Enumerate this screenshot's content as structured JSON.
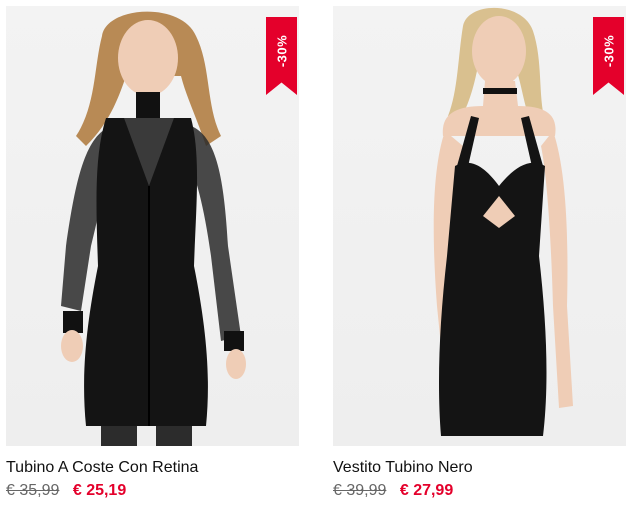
{
  "products": [
    {
      "name": "Tubino A Coste Con Retina",
      "discount": "-30%",
      "old_price": "€ 35,99",
      "new_price": "€ 25,19",
      "image_icon": "product-photo"
    },
    {
      "name": "Vestito Tubino Nero",
      "discount": "-30%",
      "old_price": "€ 39,99",
      "new_price": "€ 27,99",
      "image_icon": "product-photo"
    }
  ],
  "colors": {
    "sale": "#e4002b",
    "text": "#111111",
    "old_price": "#666666"
  }
}
